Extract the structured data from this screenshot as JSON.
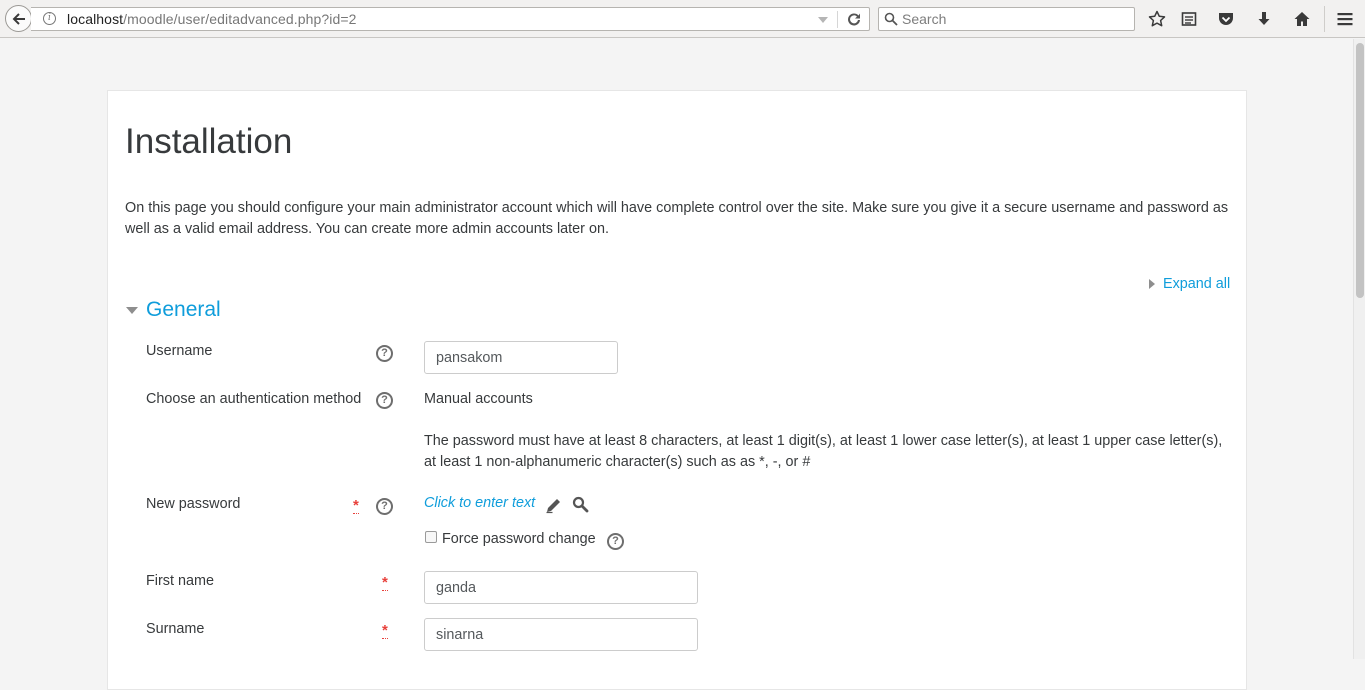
{
  "browser": {
    "url_host": "localhost",
    "url_path": "/moodle/user/editadvanced.php?id=2",
    "search_placeholder": "Search",
    "icons": [
      "back-arrow-icon",
      "info-icon",
      "reload-icon",
      "search-icon",
      "bookmark-star-icon",
      "reader-icon",
      "pocket-icon",
      "download-icon",
      "home-icon",
      "menu-icon"
    ]
  },
  "page": {
    "title": "Installation",
    "intro": "On this page you should configure your main administrator account which will have complete control over the site. Make sure you give it a secure username and password as well as a valid email address. You can create more admin accounts later on.",
    "expand_all": "Expand all"
  },
  "section": {
    "title": "General"
  },
  "form": {
    "username_label": "Username",
    "username_value": "pansakom",
    "auth_label": "Choose an authentication method",
    "auth_value": "Manual accounts",
    "password_policy": "The password must have at least 8 characters, at least 1 digit(s), at least 1 lower case letter(s), at least 1 upper case letter(s), at least 1 non-alphanumeric character(s) such as as *, -, or #",
    "new_password_label": "New password",
    "new_password_placeholder": "Click to enter text",
    "force_change_label": "Force password change",
    "force_change_checked": false,
    "firstname_label": "First name",
    "firstname_value": "ganda",
    "surname_label": "Surname",
    "surname_value": "sinarna",
    "required_mark": "*",
    "help_mark": "?"
  },
  "colors": {
    "link": "#0f9ddb",
    "required": "#e8403b",
    "text": "#373a3c"
  }
}
